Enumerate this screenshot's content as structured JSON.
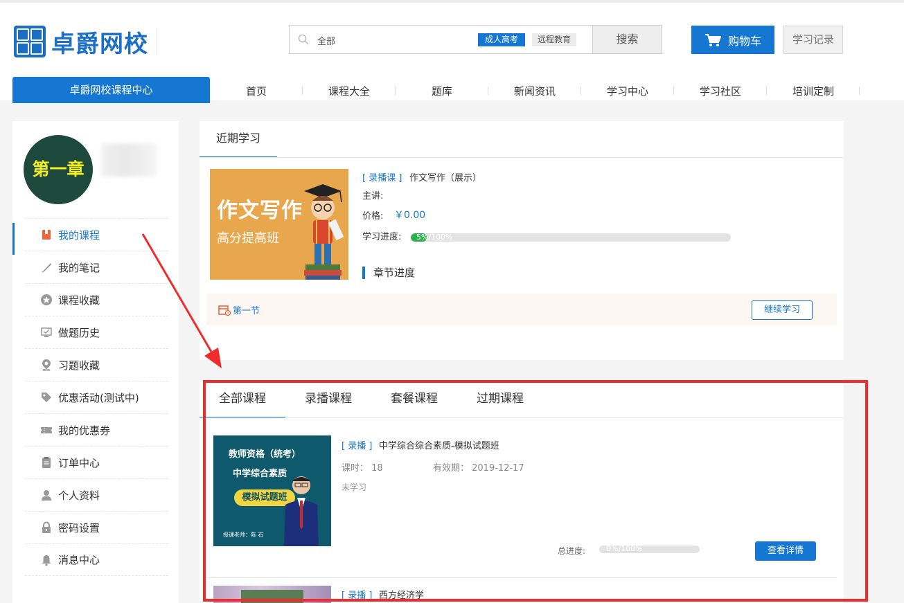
{
  "header": {
    "logo_text": "卓爵网校",
    "search": {
      "placeholder": "全部",
      "tag_primary": "成人高考",
      "tag_secondary": "远程教育",
      "button": "搜索"
    },
    "cart_label": "购物车",
    "record_label": "学习记录"
  },
  "nav": {
    "main": "卓爵网校课程中心",
    "items": [
      "首页",
      "课程大全",
      "题库",
      "新闻资讯",
      "学习中心",
      "学习社区",
      "培训定制"
    ]
  },
  "sidebar": {
    "avatar_text": "第一章",
    "menu": [
      {
        "label": "我的课程",
        "icon": "book-icon",
        "active": true
      },
      {
        "label": "我的笔记",
        "icon": "pen-icon"
      },
      {
        "label": "课程收藏",
        "icon": "star-icon"
      },
      {
        "label": "做题历史",
        "icon": "monitor-icon"
      },
      {
        "label": "习题收藏",
        "icon": "location-pin-icon"
      },
      {
        "label": "优惠活动(测试中)",
        "icon": "tag-icon"
      },
      {
        "label": "我的优惠券",
        "icon": "ticket-icon"
      },
      {
        "label": "订单中心",
        "icon": "clipboard-icon"
      },
      {
        "label": "个人资料",
        "icon": "user-icon"
      },
      {
        "label": "密码设置",
        "icon": "lock-icon"
      },
      {
        "label": "消息中心",
        "icon": "bell-icon"
      }
    ]
  },
  "recent": {
    "tab": "近期学习",
    "thumb_title": "作文写作",
    "thumb_sub": "高分提高班",
    "type": "[ 录播课 ]",
    "title": "作文写作（展示）",
    "lecturer_label": "主讲:",
    "price_label": "价格:",
    "price": "￥0.00",
    "progress_label": "学习进度:",
    "progress_text": "5%/100%",
    "progress": 0.05,
    "chapter_label": "章节进度",
    "section": "第一节",
    "continue": "继续学习"
  },
  "courses": {
    "tabs": [
      "全部课程",
      "录播课程",
      "套餐课程",
      "过期课程"
    ],
    "items": [
      {
        "thumb_l1": "教师资格（统考）",
        "thumb_l2": "中学综合素质",
        "thumb_l3": "模拟试题班",
        "thumb_l4": "授课老师：陈 石",
        "type": "[ 录播 ]",
        "title": "中学综合综合素质-模拟试题班",
        "hours": "课时：  18",
        "valid": "有效期：  2019-12-17",
        "status": "未学习",
        "total_label": "总进度:",
        "progress_text": "0%/100%",
        "progress": 0,
        "button": "查看详情"
      },
      {
        "type": "[ 录播 ]",
        "title": "西方经济学"
      }
    ]
  },
  "colors": {
    "accent": "#1677d2",
    "highlight": "#ef2b2b",
    "progress": "#2bb24c"
  }
}
